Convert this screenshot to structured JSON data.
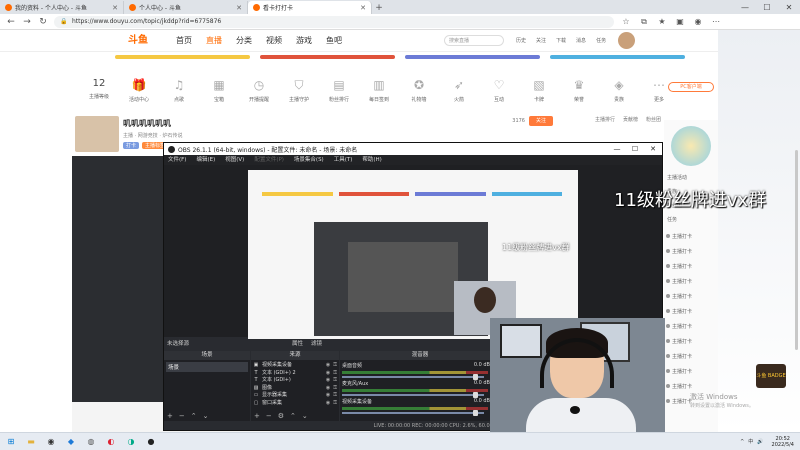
{
  "browser": {
    "tabs": [
      {
        "title": "我的资料 - 个人中心 - 斗鱼",
        "active": false
      },
      {
        "title": "个人中心 - 斗鱼",
        "active": false
      },
      {
        "title": "看卡打打卡",
        "active": true
      }
    ],
    "url": "https://www.douyu.com/topic/jkddp?rid=6775876",
    "new_tab": "+",
    "window_controls": {
      "minimize": "—",
      "maximize": "☐",
      "close": "✕"
    },
    "nav": {
      "back": "←",
      "forward": "→",
      "reload": "↻"
    }
  },
  "douyu": {
    "logo": "斗鱼",
    "nav_items": [
      "首页",
      "直播",
      "分类",
      "视频",
      "游戏",
      "鱼吧"
    ],
    "nav_active_index": 1,
    "search_placeholder": "搜索直播",
    "header_icons": [
      "历史",
      "关注",
      "下载",
      "消息",
      "任务"
    ],
    "color_bars": [
      "#f5c842",
      "#e0533b",
      "#6c7bd6",
      "#4fb0e0"
    ],
    "toolbar": [
      {
        "icon": "calendar-icon",
        "label": "主播等级",
        "num": "12"
      },
      {
        "icon": "gift-icon",
        "label": "活动中心",
        "num": ""
      },
      {
        "icon": "music-icon",
        "label": "点歌",
        "num": ""
      },
      {
        "icon": "box-icon",
        "label": "宝箱",
        "num": ""
      },
      {
        "icon": "clock-icon",
        "label": "开播提醒",
        "num": ""
      },
      {
        "icon": "shield-icon",
        "label": "主播守护",
        "num": ""
      },
      {
        "icon": "chart-icon",
        "label": "粉丝排行",
        "num": ""
      },
      {
        "icon": "calendar-icon",
        "label": "每日签到",
        "num": ""
      },
      {
        "icon": "star-icon",
        "label": "礼物墙",
        "num": ""
      },
      {
        "icon": "rocket-icon",
        "label": "火箭",
        "num": ""
      },
      {
        "icon": "heart-icon",
        "label": "互动",
        "num": ""
      },
      {
        "icon": "cards-icon",
        "label": "卡牌",
        "num": ""
      },
      {
        "icon": "trophy-icon",
        "label": "荣誉",
        "num": ""
      },
      {
        "icon": "vip-icon",
        "label": "贵族",
        "num": ""
      },
      {
        "icon": "more-icon",
        "label": "更多",
        "num": ""
      }
    ],
    "room": {
      "title": "叽叽叽叽叽叽",
      "meta": "主播 · 网游竞技 · 炉石传说",
      "tags": [
        "打卡",
        "主播标签"
      ],
      "follow_count": "3176",
      "follow_label": "关注",
      "rank_tabs": [
        "主播排行",
        "贡献榜",
        "粉丝团"
      ]
    },
    "pc_download": "PC客户端",
    "side_items": [
      "主播活动",
      "贵族",
      "粉丝团",
      "任务"
    ],
    "chat_lines": [
      "主播打卡",
      "主播打卡",
      "主播打卡",
      "主播打卡",
      "主播打卡",
      "主播打卡",
      "主播打卡",
      "主播打卡",
      "主播打卡",
      "主播打卡",
      "主播打卡",
      "主播打卡"
    ],
    "overlay_text": "11级粉丝牌进vx群",
    "badge_text": "斗鱼 BADGE"
  },
  "obs": {
    "title": "OBS 26.1.1 (64-bit, windows) - 配置文件: 未命名 - 场景: 未命名",
    "menu": [
      "文件(F)",
      "编辑(E)",
      "视图(V)",
      "配置文件(P)",
      "场景集合(S)",
      "工具(T)",
      "帮助(H)"
    ],
    "menu_dim_index": 3,
    "docks_header": "未选择源",
    "docks_header_right": [
      "属性",
      "滤镜"
    ],
    "panels": {
      "scenes": {
        "title": "场景",
        "items": [
          "场景"
        ]
      },
      "sources": {
        "title": "来源",
        "items": [
          {
            "icon": "camera-icon",
            "name": "视频采集设备"
          },
          {
            "icon": "text-icon",
            "name": "文本 (GDI+) 2"
          },
          {
            "icon": "text-icon",
            "name": "文本 (GDI+)"
          },
          {
            "icon": "image-icon",
            "name": "图像"
          },
          {
            "icon": "monitor-icon",
            "name": "显示器采集"
          },
          {
            "icon": "window-icon",
            "name": "窗口采集"
          }
        ]
      },
      "mixer": {
        "title": "混音器",
        "channels": [
          {
            "name": "桌面音频",
            "db": "0.0 dB",
            "level": 0.92
          },
          {
            "name": "麦克风/Aux",
            "db": "0.0 dB",
            "level": 0.92
          },
          {
            "name": "视频采集设备",
            "db": "0.0 dB",
            "level": 0.92
          }
        ]
      }
    },
    "preview_overlay_text": "11级粉丝牌进vx群",
    "status": "LIVE: 00:00:00   REC: 00:00:00   CPU: 2.6%, 60.00 fps"
  },
  "taskbar": {
    "icons": [
      "start-icon",
      "explorer-icon",
      "obs-icon",
      "app-icon",
      "browser-icon",
      "edge-icon",
      "chrome-icon",
      "obs2-icon"
    ],
    "time": "20:52",
    "date": "2022/5/4",
    "tray": [
      "^",
      "中",
      "🔊"
    ]
  },
  "watermark": {
    "title": "激活 Windows",
    "sub": "转到设置以激活 Windows。"
  }
}
